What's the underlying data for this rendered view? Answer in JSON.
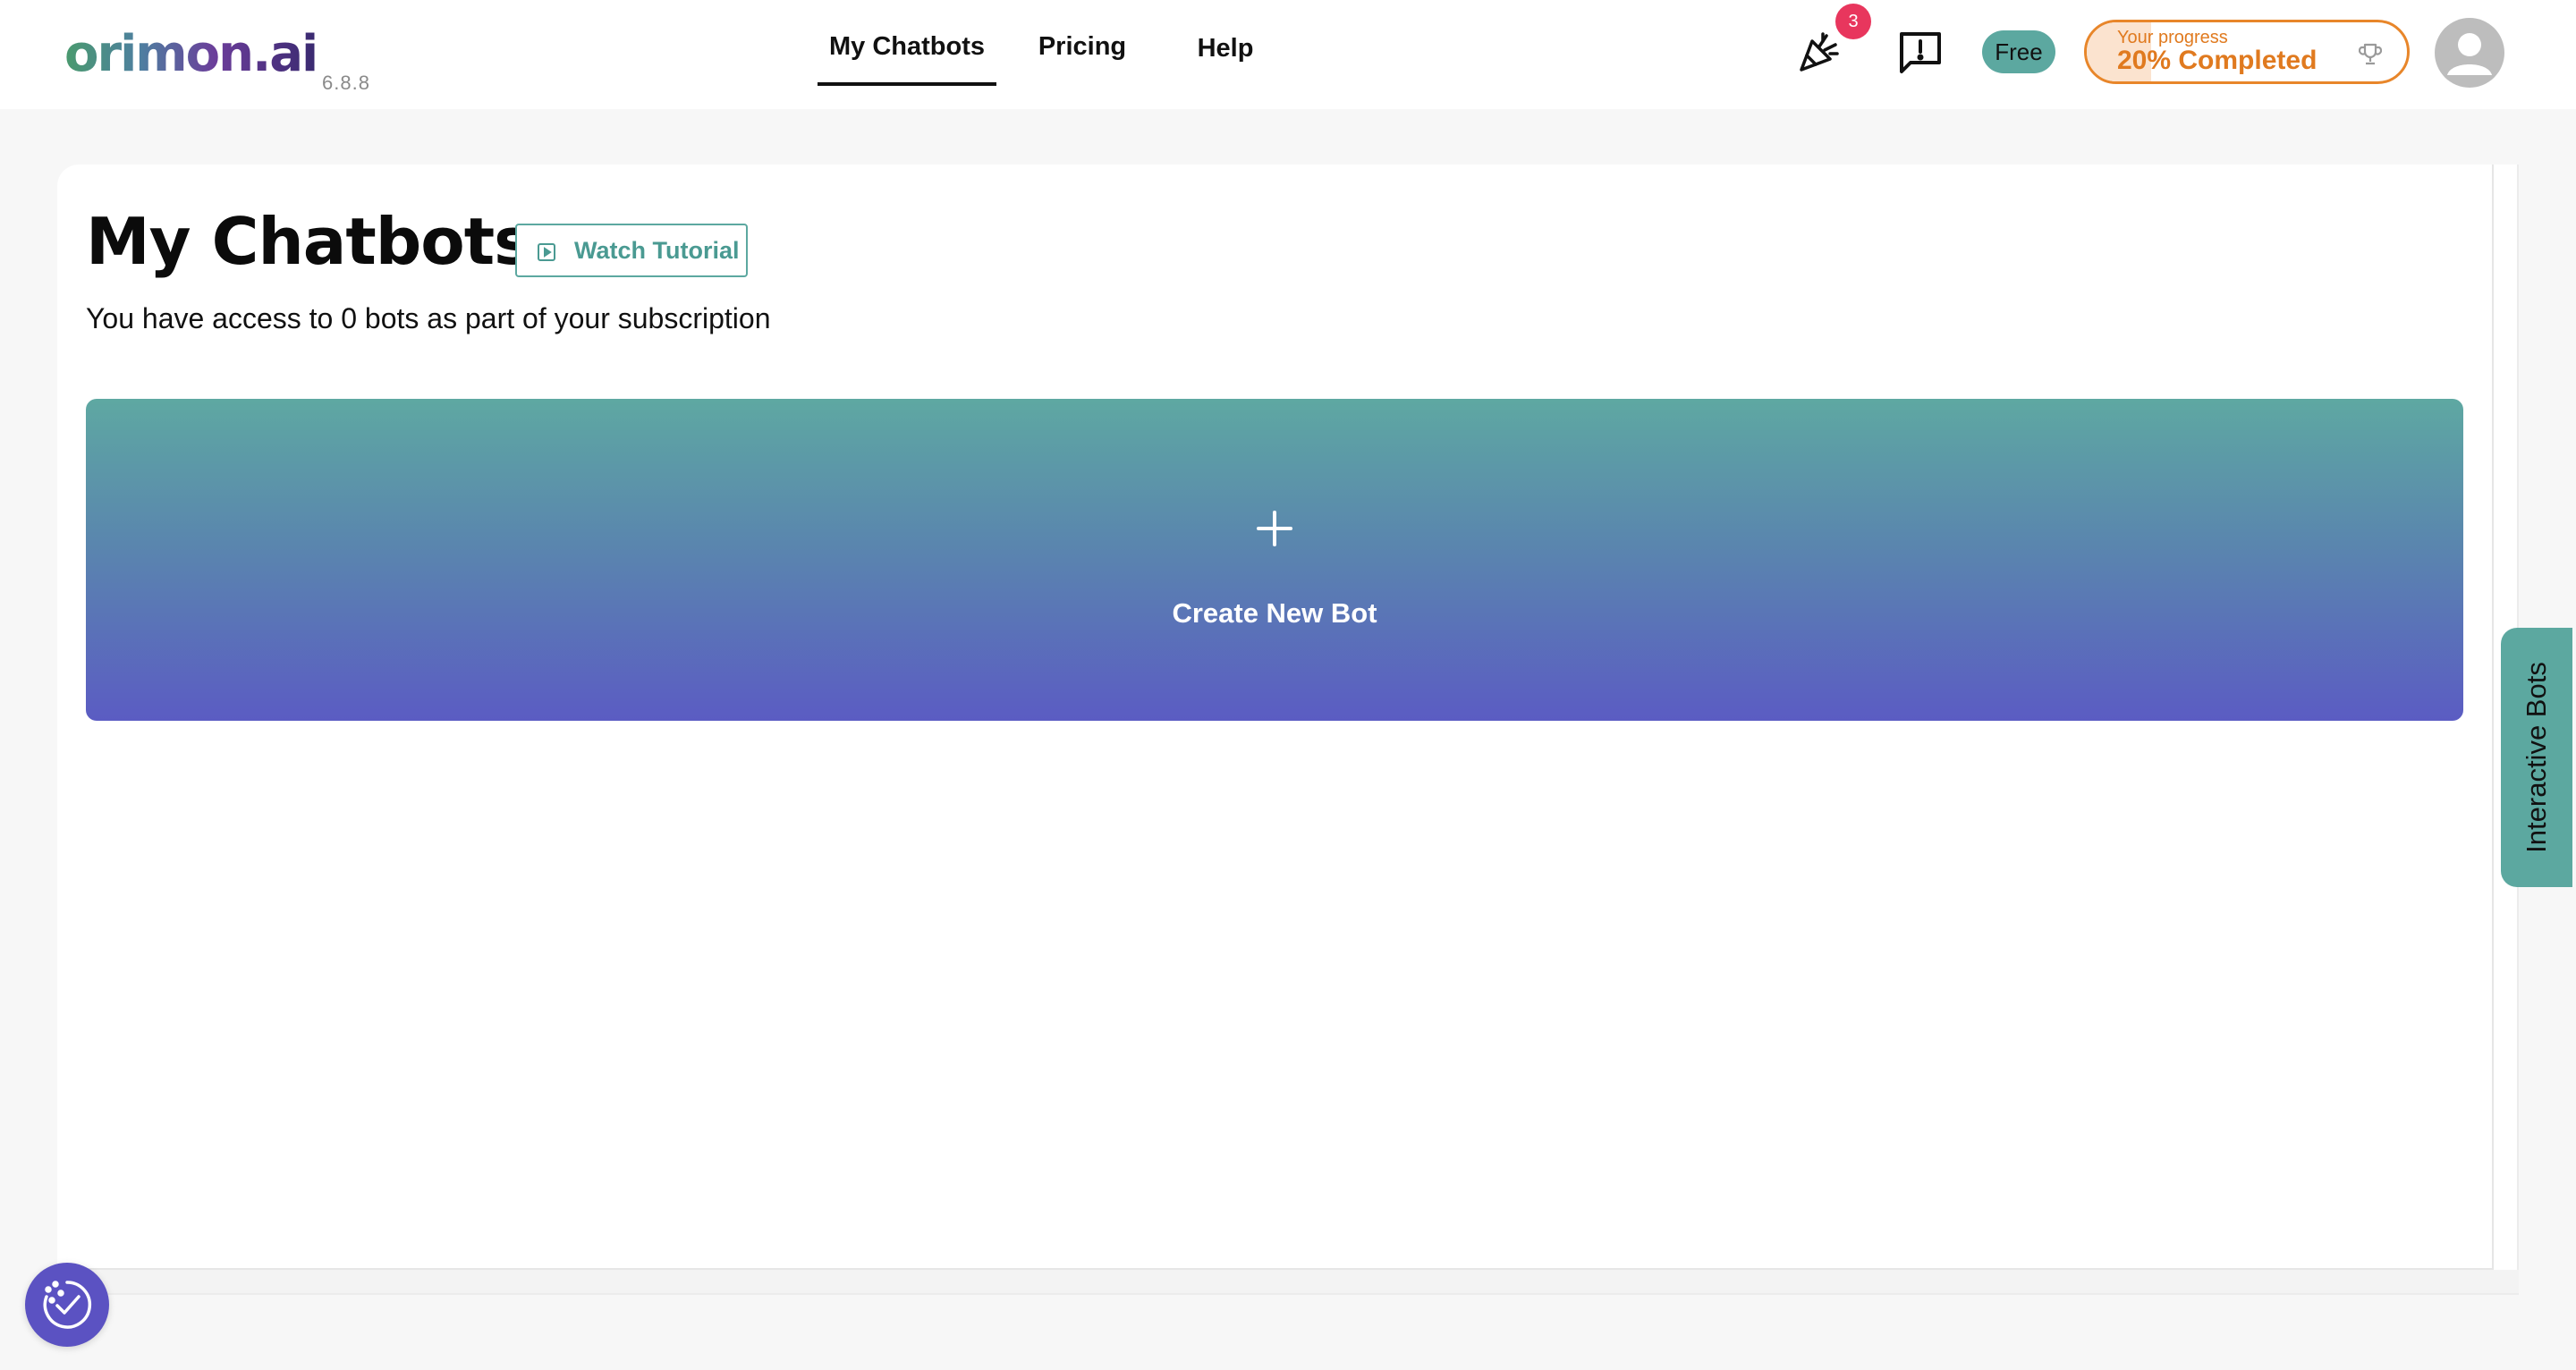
{
  "header": {
    "logo_text": "orimon.ai",
    "version": "6.8.8",
    "nav": [
      {
        "label": "My Chatbots",
        "active": true
      },
      {
        "label": "Pricing",
        "active": false
      },
      {
        "label": "Help",
        "active": false
      }
    ],
    "notifications_count": "3",
    "plan_label": "Free",
    "progress": {
      "label": "Your progress",
      "value_text": "20% Completed",
      "percent": 20
    },
    "icons": {
      "announcements": "party-popper-icon",
      "feedback": "feedback-icon",
      "trophy": "trophy-icon",
      "avatar": "user-avatar-icon"
    }
  },
  "main": {
    "title": "My Chatbots",
    "tutorial_label": "Watch Tutorial",
    "subtitle": "You have access to 0 bots as part of your subscription",
    "create_label": "Create New Bot"
  },
  "side_tab": {
    "label": "Interactive Bots"
  },
  "colors": {
    "accent_teal": "#5ca8a0",
    "accent_purple": "#5b5cc3",
    "progress_orange": "#e07a1f",
    "badge_red": "#e8365d"
  }
}
